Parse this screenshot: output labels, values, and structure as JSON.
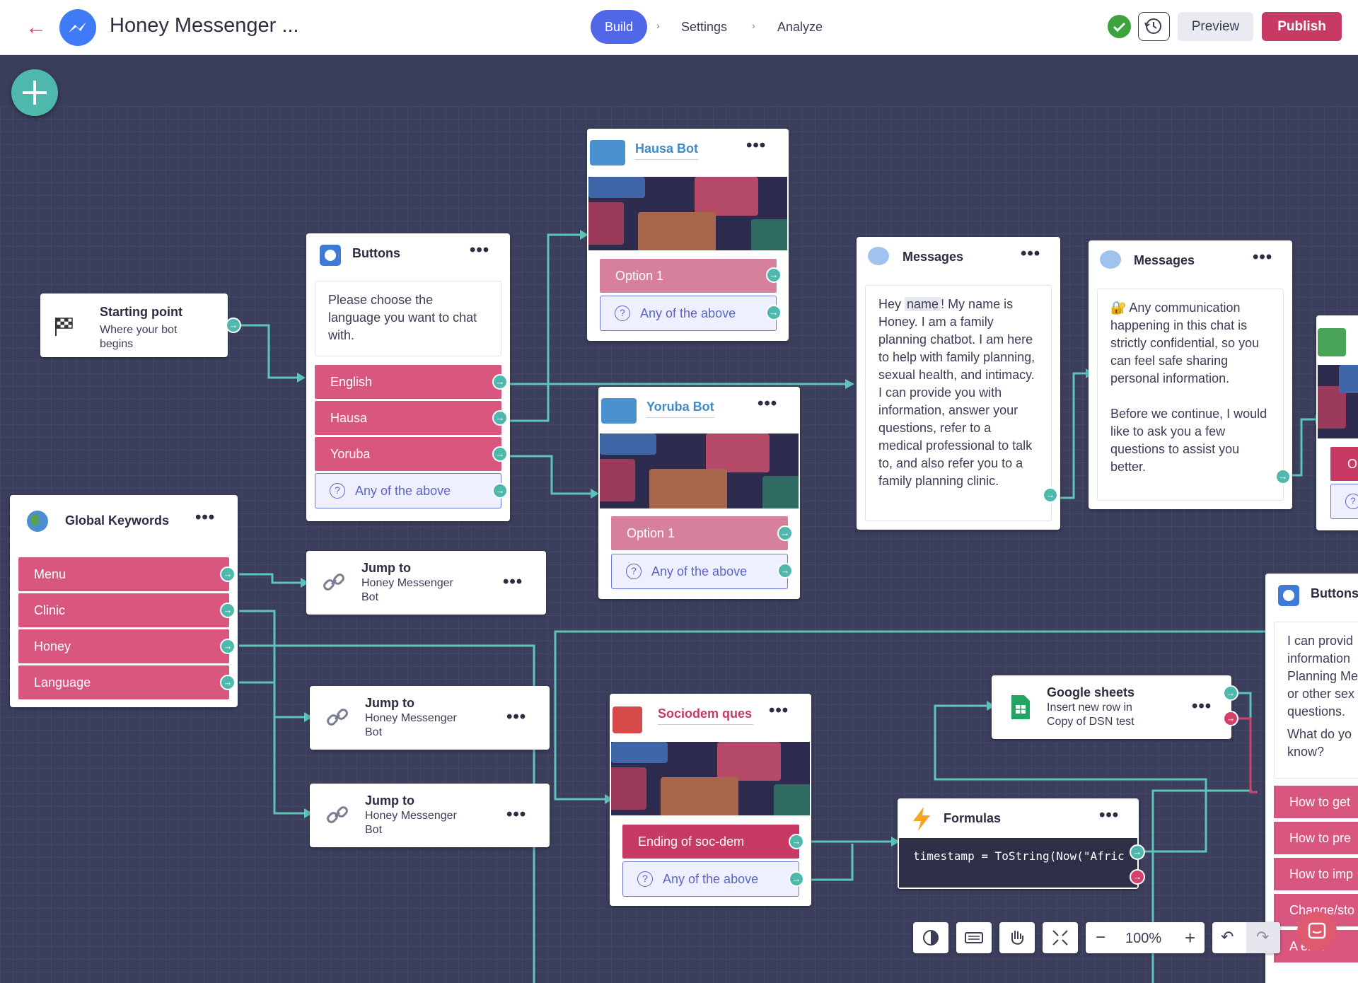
{
  "header": {
    "title": "Honey Messenger ...",
    "breadcrumbs": [
      "Build",
      "Settings",
      "Analyze"
    ],
    "preview_label": "Preview",
    "publish_label": "Publish"
  },
  "nodes": {
    "start": {
      "title": "Starting point",
      "subtitle": "Where your bot begins"
    },
    "buttons": {
      "title": "Buttons",
      "text": "Please choose the language you want to chat with.",
      "options": [
        "English",
        "Hausa",
        "Yoruba"
      ],
      "fallback": "Any of the above"
    },
    "hausa": {
      "title": "Hausa Bot",
      "option": "Option 1",
      "fallback": "Any of the above"
    },
    "yoruba": {
      "title": "Yoruba Bot",
      "option": "Option 1",
      "fallback": "Any of the above"
    },
    "messages1": {
      "title": "Messages",
      "greeting_prefix": "Hey",
      "variable": "name",
      "greeting_suffix": "! My name is Honey. I am a family planning chatbot. I am here to help with family planning, sexual health, and intimacy.  I can provide you with information, answer your questions, refer to a medical professional to talk to, and also refer you to a family planning clinic."
    },
    "messages2": {
      "title": "Messages",
      "para1": "🔐 Any communication happening in this chat is strictly confidential, so you can feel safe sharing personal information.",
      "para2": "Before we continue, I would like to ask you a few questions to assist you better."
    },
    "global": {
      "title": "Global Keywords",
      "keywords": [
        "Menu",
        "Clinic",
        "Honey",
        "Language"
      ]
    },
    "jump1": {
      "title": "Jump to",
      "target": "Honey Messenger Bot"
    },
    "jump2": {
      "title": "Jump to",
      "target": "Honey Messenger Bot"
    },
    "jump3": {
      "title": "Jump to",
      "target": "Honey Messenger Bot"
    },
    "sociodem": {
      "title": "Sociodem ques",
      "option": "Ending of soc-dem",
      "fallback": "Any of the above"
    },
    "sheets": {
      "title": "Google sheets",
      "line1": "Insert new row in",
      "line2": "Copy of DSN test"
    },
    "formulas": {
      "title": "Formulas",
      "code": "timestamp = ToString(Now(\"Afric"
    },
    "buttons2": {
      "title": "Buttons",
      "text": [
        "I can provid",
        "information",
        "Planning Me",
        "or other sex",
        "questions.",
        "What do yo",
        "know?"
      ],
      "options": [
        "How to get",
        "How to pre",
        "How to imp",
        "Change/sto",
        "A    ener"
      ]
    },
    "edge_partial": {
      "option": "O"
    }
  },
  "toolbar": {
    "zoom": "100%"
  },
  "colors": {
    "canvas": "#3b3f5d",
    "wire": "#5ec4b8",
    "option_pink": "#d9567f",
    "publish": "#c73a63",
    "build_pill": "#5067e8"
  }
}
